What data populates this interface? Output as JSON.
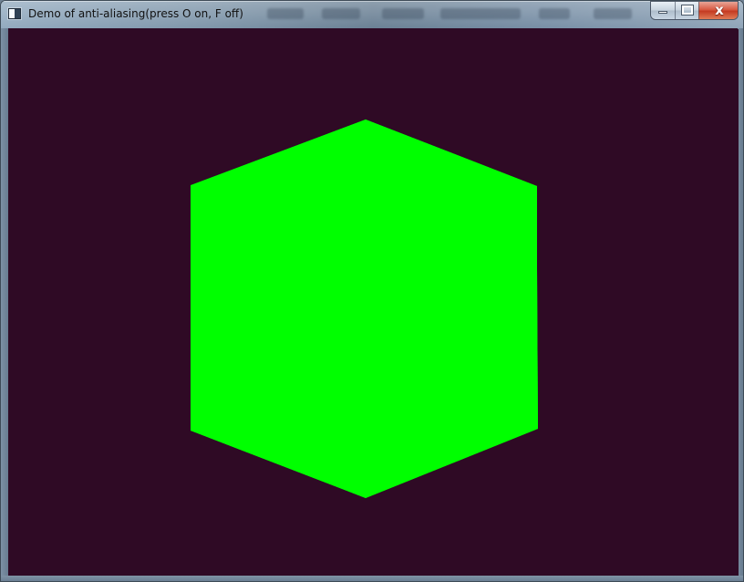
{
  "window": {
    "title": "Demo of anti-aliasing(press O on, F off)",
    "controls": {
      "minimize_icon": "minimize-icon",
      "maximize_icon": "maximize-icon",
      "close_icon": "close-icon",
      "close_glyph": "x"
    }
  },
  "canvas": {
    "background": "#2f0a25",
    "shape_color": "#00ff00",
    "shape_name": "hexagon-cube"
  },
  "icons": {
    "app": "application-icon"
  }
}
